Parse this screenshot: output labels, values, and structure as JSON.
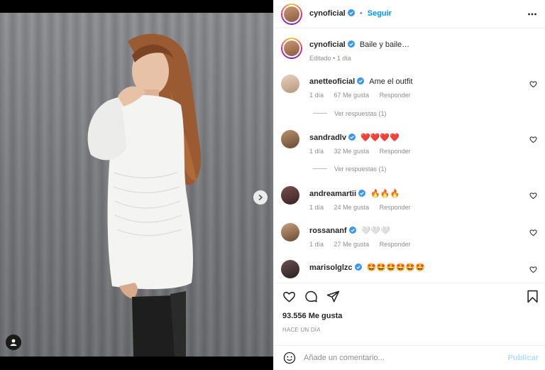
{
  "post": {
    "author": "cynoficial",
    "follow_label": "Seguir",
    "separator": "•",
    "more_icon": "more-horizontal-icon",
    "carousel_dots": 3,
    "active_dot": 0,
    "caption_text": "Baile y baile…",
    "edited_label": "Editado",
    "edited_separator": "•",
    "edited_time": "1 día"
  },
  "comments": [
    {
      "user": "anetteoficial",
      "verified": true,
      "text": "Ame el outfit",
      "time": "1 día",
      "likes": "67 Me gusta",
      "reply": "Responder",
      "replies_label": "Ver respuestas (1)",
      "avatar_color": "#d9c2ae"
    },
    {
      "user": "sandradlv",
      "verified": true,
      "text": "❤️❤️❤️❤️",
      "time": "1 día",
      "likes": "32 Me gusta",
      "reply": "Responder",
      "replies_label": "Ver respuestas (1)",
      "avatar_color": "#8a6a4a"
    },
    {
      "user": "andreamartii",
      "verified": true,
      "text": "🔥🔥🔥",
      "time": "1 día",
      "likes": "24 Me gusta",
      "reply": "Responder",
      "avatar_color": "#5a3a3a"
    },
    {
      "user": "rossananf",
      "verified": true,
      "text": "🤍🤍🤍",
      "time": "1 día",
      "likes": "27 Me gusta",
      "reply": "Responder",
      "avatar_color": "#a07a5a"
    },
    {
      "user": "marisolglzc",
      "verified": true,
      "text": "🤩🤩🤩🤩🤩🤩",
      "avatar_color": "#3a3030"
    }
  ],
  "actions": {
    "like_icon": "heart-icon",
    "comment_icon": "comment-icon",
    "share_icon": "share-icon",
    "save_icon": "bookmark-icon",
    "likes_count": "93.556 Me gusta",
    "time_ago": "HACE UN DÍA"
  },
  "add_comment": {
    "placeholder": "Añade un comentario...",
    "publish_label": "Publicar",
    "emoji_icon": "smiley-icon"
  },
  "colors": {
    "accent": "#0095f6",
    "verified": "#3897f0",
    "publish_disabled": "#b2dffc"
  }
}
